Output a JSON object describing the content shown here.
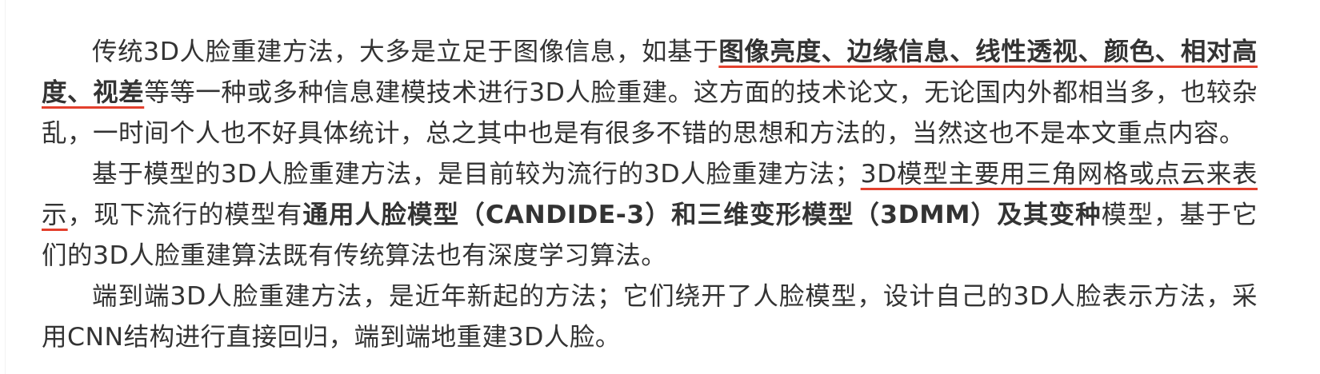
{
  "accent_colors": {
    "underline": "#e3402d",
    "text": "#333333"
  },
  "paragraphs": [
    {
      "segments": [
        {
          "text": "传统3D人脸重建方法，大多是立足于图像信息，如基于",
          "bold": false,
          "underline": false
        },
        {
          "text": "图像亮度、边缘信息、线性透视、颜色、相对高度、视差",
          "bold": true,
          "underline": true
        },
        {
          "text": "等等一种或多种信息建模技术进行3D人脸重建。这方面的技术论文，无论国内外都相当多，也较杂乱，一时间个人也不好具体统计，总之其中也是有很多不错的思想和方法的，当然这也不是本文重点内容。",
          "bold": false,
          "underline": false
        }
      ]
    },
    {
      "segments": [
        {
          "text": "基于模型的3D人脸重建方法，是目前较为流行的3D人脸重建方法；",
          "bold": false,
          "underline": false
        },
        {
          "text": "3D模型主要用三角网格或点云来表示",
          "bold": false,
          "underline": true
        },
        {
          "text": "，现下流行的模型有",
          "bold": false,
          "underline": false
        },
        {
          "text": "通用人脸模型（CANDIDE-3）和三维变形模型（3DMM）及其变种",
          "bold": true,
          "underline": false
        },
        {
          "text": "模型，基于它们的3D人脸重建算法既有传统算法也有深度学习算法。",
          "bold": false,
          "underline": false
        }
      ]
    },
    {
      "segments": [
        {
          "text": "端到端3D人脸重建方法，是近年新起的方法；它们绕开了人脸模型，设计自己的3D人脸表示方法，采用CNN结构进行直接回归，端到端地重建3D人脸。",
          "bold": false,
          "underline": false
        }
      ]
    }
  ]
}
